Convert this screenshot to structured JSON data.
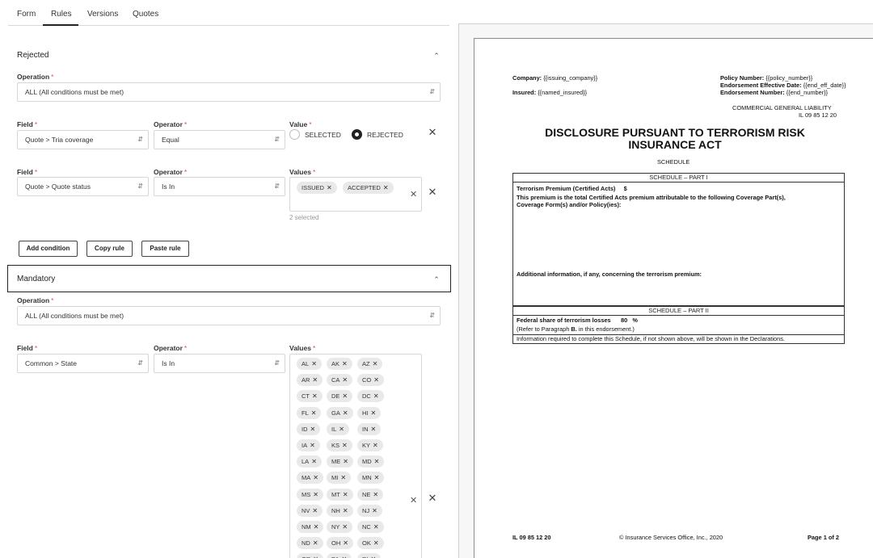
{
  "tabs": [
    "Form",
    "Rules",
    "Versions",
    "Quotes"
  ],
  "active_tab": "Rules",
  "rejected": {
    "title": "Rejected",
    "operation_label": "Operation",
    "operation_value": "ALL (All conditions must be met)",
    "cond1": {
      "field_label": "Field",
      "field_value": "Quote > Tria coverage",
      "operator_label": "Operator",
      "operator_value": "Equal",
      "value_label": "Value",
      "options": [
        "SELECTED",
        "REJECTED"
      ],
      "selected_option": "REJECTED"
    },
    "cond2": {
      "field_label": "Field",
      "field_value": "Quote > Quote status",
      "operator_label": "Operator",
      "operator_value": "Is In",
      "values_label": "Values",
      "chips": [
        "ISSUED",
        "ACCEPTED"
      ],
      "hint": "2 selected"
    },
    "buttons": {
      "add": "Add condition",
      "copy": "Copy rule",
      "paste": "Paste rule"
    }
  },
  "mandatory": {
    "title": "Mandatory",
    "operation_label": "Operation",
    "operation_value": "ALL (All conditions must be met)",
    "cond1": {
      "field_label": "Field",
      "field_value": "Common > State",
      "operator_label": "Operator",
      "operator_value": "Is In",
      "values_label": "Values",
      "chips": [
        "AL",
        "AK",
        "AZ",
        "AR",
        "CA",
        "CO",
        "CT",
        "DE",
        "DC",
        "FL",
        "GA",
        "HI",
        "ID",
        "IL",
        "IN",
        "IA",
        "KS",
        "KY",
        "LA",
        "ME",
        "MD",
        "MA",
        "MI",
        "MN",
        "MS",
        "MT",
        "NE",
        "NV",
        "NH",
        "NJ",
        "NM",
        "NY",
        "NC",
        "ND",
        "OH",
        "OK",
        "OR",
        "PA",
        "RI"
      ]
    }
  },
  "icons": {
    "chevron_up": "chevron-up-icon",
    "close": "close-icon",
    "updown": "select-arrows-icon"
  },
  "doc": {
    "company_label": "Company:",
    "company_value": "{{issuing_company}}",
    "insured_label": "Insured:",
    "insured_value": "{{named_insured}}",
    "policy_label": "Policy Number:",
    "policy_value": "{{policy_number}}",
    "eff_label": "Endorsement Effective Date:",
    "eff_value": "{{end_eff_date}}",
    "endno_label": "Endorsement Number:",
    "endno_value": "{{end_number}}",
    "line": "COMMERCIAL GENERAL LIABILITY",
    "form_no": "IL 09 85 12 20",
    "title_line1": "DISCLOSURE PURSUANT TO TERRORISM RISK",
    "title_line2": "INSURANCE ACT",
    "schedule": "SCHEDULE",
    "part1": "SCHEDULE – PART I",
    "premium_label": "Terrorism Premium (Certified Acts)",
    "premium_dollar": "$",
    "premium_desc1": "This premium is the total Certified Acts premium attributable to the following Coverage Part(s),",
    "premium_desc2": "Coverage Form(s) and/or Policy(ies):",
    "additional": "Additional information, if any, concerning the terrorism premium:",
    "part2": "SCHEDULE – PART II",
    "federal_label": "Federal share of terrorism losses",
    "federal_value": "80",
    "federal_pct": "%",
    "refer": "(Refer to Paragraph",
    "refer_b": "B.",
    "refer_end": "in this endorsement.)",
    "info": "Information required to complete this Schedule, if not shown above, will be shown in the Declarations.",
    "footer_form": "IL 09 85 12 20",
    "footer_copy": "© Insurance Services Office, Inc., 2020",
    "footer_page": "Page 1 of 2"
  }
}
